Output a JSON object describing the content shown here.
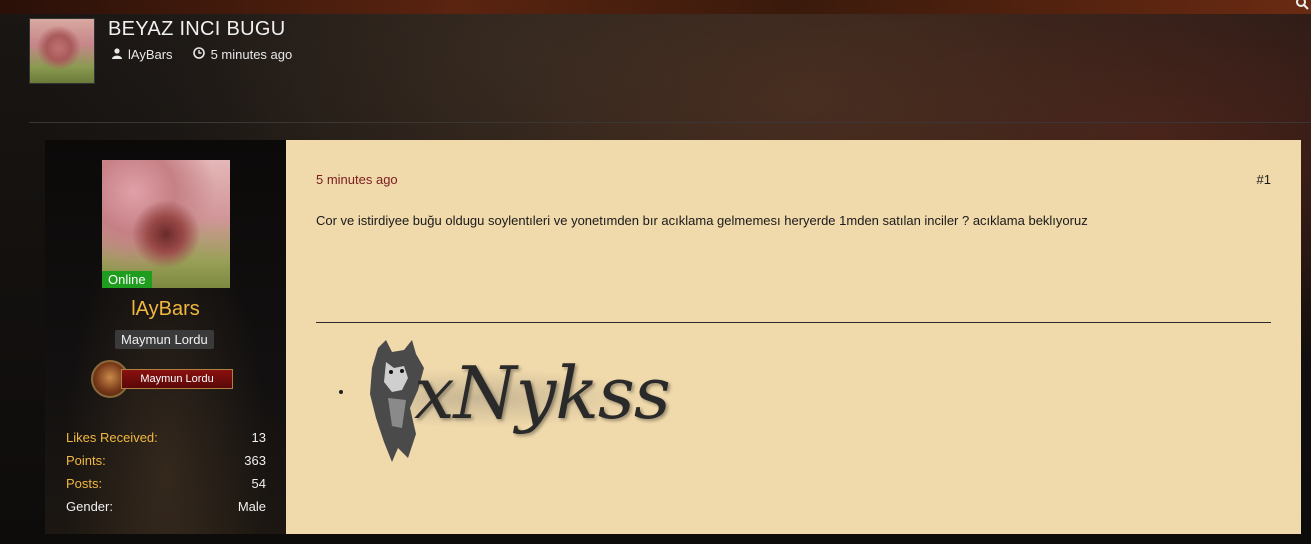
{
  "thread": {
    "title": "BEYAZ INCI BUGU",
    "author": "lAyBars",
    "time": "5 minutes ago"
  },
  "user": {
    "name": "lAyBars",
    "status": "Online",
    "title": "Maymun Lordu",
    "rank_banner": "Maymun Lordu",
    "stats": [
      {
        "label": "Likes Received:",
        "value": "13"
      },
      {
        "label": "Points:",
        "value": "363"
      },
      {
        "label": "Posts:",
        "value": "54"
      },
      {
        "label": "Gender:",
        "value": "Male"
      }
    ]
  },
  "post": {
    "date": "5 minutes ago",
    "number": "#1",
    "body": "Cor ve istirdiyee buğu oldugu soylentıleri ve yonetımden bır acıklama gelmemesı heryerde 1mden satılan inciler ? acıklama beklıyoruz",
    "signature_text": "xNykss"
  },
  "icons": {
    "author": "user-icon",
    "time": "clock-icon"
  },
  "colors": {
    "accent_gold": "#f0b840",
    "post_bg": "#f0d9ab",
    "online_green": "#1f9d1f",
    "date_red": "#7a2020"
  }
}
